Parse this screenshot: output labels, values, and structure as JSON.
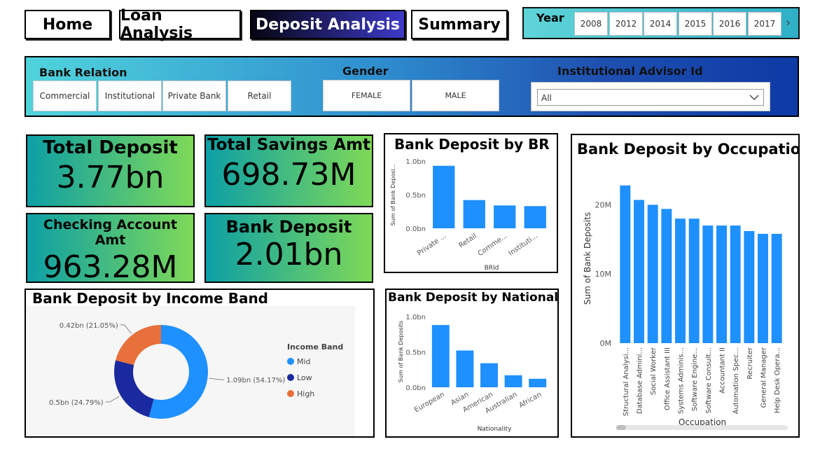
{
  "nav": {
    "home": "Home",
    "loan": "Loan Analysis",
    "deposit": "Deposit Analysis",
    "summary": "Summary"
  },
  "year_filter": {
    "label": "Year",
    "years": [
      "2008",
      "2012",
      "2014",
      "2015",
      "2016",
      "2017"
    ]
  },
  "filters": {
    "bank_relation_label": "Bank Relation",
    "bank_relation_options": [
      "Commercial",
      "Institutional",
      "Private Bank",
      "Retail"
    ],
    "gender_label": "Gender",
    "gender_options": [
      "FEMALE",
      "MALE"
    ],
    "advisor_label": "Institutional Advisor Id",
    "advisor_value": "All"
  },
  "kpis": {
    "total_deposit_label": "Total Deposit",
    "total_deposit_value": "3.77bn",
    "total_savings_label": "Total Savings Amt",
    "total_savings_value": "698.73M",
    "checking_label": "Checking Account Amt",
    "checking_value": "963.28M",
    "bank_deposit_label": "Bank Deposit",
    "bank_deposit_value": "2.01bn"
  },
  "colors": {
    "bar": "#1e90ff",
    "mid": "#1e90ff",
    "low": "#1a2a9e",
    "high": "#e8703a"
  },
  "chart_data": [
    {
      "type": "bar",
      "title": "Bank Deposit by BR",
      "xlabel": "BRId",
      "ylabel": "Sum of Bank Deposi...",
      "categories": [
        "Private ...",
        "Retail",
        "Comme...",
        "Instituti..."
      ],
      "values": [
        0.93,
        0.42,
        0.34,
        0.33
      ],
      "ylim": [
        0,
        1.0
      ],
      "yticks": [
        "0.0bn",
        "0.5bn",
        "1.0bn"
      ]
    },
    {
      "type": "bar",
      "title": "Bank Deposit by Nationality",
      "xlabel": "Nationality",
      "ylabel": "Sum of Bank Deposits",
      "categories": [
        "European",
        "Asian",
        "American",
        "Australian",
        "African"
      ],
      "values": [
        0.88,
        0.52,
        0.34,
        0.17,
        0.12
      ],
      "ylim": [
        0,
        1.0
      ],
      "yticks": [
        "0.0bn",
        "0.5bn",
        "1.0bn"
      ]
    },
    {
      "type": "bar",
      "title": "Bank Deposit by Occupation",
      "xlabel": "Occupation",
      "ylabel": "Sum of Bank Deposits",
      "categories": [
        "Structural Analysi...",
        "Database Admini...",
        "Social Worker",
        "Office Assistant III",
        "Systems Adminis...",
        "Software Engine...",
        "Software Consult...",
        "Accountant II",
        "Automation Spec...",
        "Recruiter",
        "General Manager",
        "Help Desk Opera..."
      ],
      "values": [
        22.8,
        20.7,
        20.0,
        19.4,
        18.0,
        18.0,
        17.0,
        17.0,
        17.0,
        16.2,
        15.8,
        15.8
      ],
      "ylim": [
        0,
        25
      ],
      "yticks": [
        "0M",
        "10M",
        "20M"
      ]
    },
    {
      "type": "pie",
      "title": "Bank Deposit by Income Band",
      "legend_title": "Income Band",
      "labels": [
        "Mid",
        "Low",
        "High"
      ],
      "values": [
        54.17,
        24.79,
        21.05
      ],
      "data_labels": [
        "1.09bn (54.17%)",
        "0.5bn (24.79%)",
        "0.42bn (21.05%)"
      ]
    }
  ]
}
